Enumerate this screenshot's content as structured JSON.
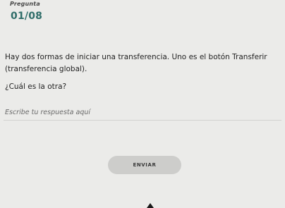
{
  "header": {
    "label": "Pregunta",
    "counter": "01/08"
  },
  "question": {
    "text": "Hay dos formas de iniciar una transferencia. Uno es el botón Transferir (transferencia global).",
    "prompt": "¿Cuál es la otra?"
  },
  "answer": {
    "placeholder": "Escribe tu respuesta aquí",
    "value": ""
  },
  "submit": {
    "label": "ENVIAR"
  }
}
